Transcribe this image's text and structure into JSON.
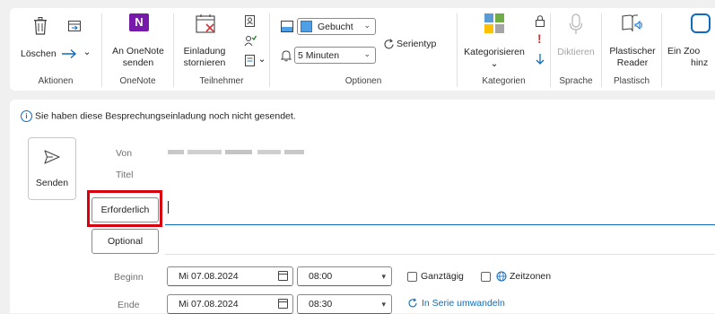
{
  "ribbon": {
    "aktionen": {
      "group_label": "Aktionen",
      "delete_label": "Löschen",
      "delete_chevron": "⌄"
    },
    "onenote": {
      "group_label": "OneNote",
      "send_line1": "An OneNote",
      "send_line2": "senden",
      "logo_letter": "N"
    },
    "teilnehmer": {
      "group_label": "Teilnehmer",
      "cancel_line1": "Einladung",
      "cancel_line2": "stornieren",
      "chevron": "⌄"
    },
    "optionen": {
      "group_label": "Optionen",
      "show_as_value": "Gebucht",
      "reminder_value": "5 Minuten",
      "recurrence_label": "Serientyp",
      "chevron": "⌄"
    },
    "kategorien": {
      "group_label": "Kategorien",
      "categorize_label": "Kategorisieren",
      "chevron": "⌄",
      "importance_mark": "!"
    },
    "sprache": {
      "group_label": "Sprache",
      "dictate_label": "Diktieren"
    },
    "plastisch": {
      "group_label": "Plastisch",
      "reader_line1": "Plastischer",
      "reader_line2": "Reader"
    },
    "zoom": {
      "line1": "Ein Zoo",
      "line2": "hinz"
    }
  },
  "infobar": {
    "icon_glyph": "i",
    "text": "Sie haben diese Besprechungseinladung noch nicht gesendet."
  },
  "compose": {
    "send_label": "Senden",
    "from_label": "Von",
    "title_label": "Titel",
    "required_label": "Erforderlich",
    "optional_label": "Optional",
    "start_label": "Beginn",
    "end_label": "Ende",
    "start_date": "Mi 07.08.2024",
    "start_time": "08:00",
    "end_date": "Mi 07.08.2024",
    "end_time": "08:30",
    "allday_label": "Ganztägig",
    "timezones_label": "Zeitzonen",
    "recurring_link": "In Serie umwandeln",
    "dropdown_glyph": "▾"
  },
  "colors": {
    "accent": "#0f6cbd",
    "highlight": "#d9000d",
    "onenote": "#7719aa",
    "busy": "#4f9fe6"
  }
}
